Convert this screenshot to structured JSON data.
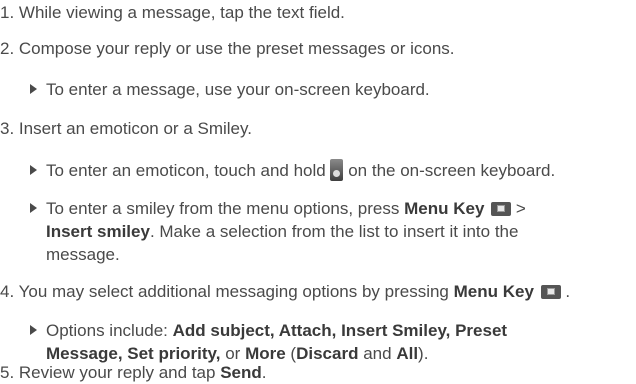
{
  "steps": {
    "s1": {
      "text": "1. While viewing a message, tap the text field."
    },
    "s2": {
      "text": "2. Compose your reply or use the preset messages or icons."
    },
    "s2_b1": {
      "text": "To enter a message, use your on-screen keyboard."
    },
    "s3": {
      "text": "3. Insert an emoticon or a Smiley."
    },
    "s3_b1": {
      "before": "To enter an emoticon, touch and hold",
      "after": "on the on-screen keyboard.",
      "icon": "emoticon-key-icon"
    },
    "s3_b2": {
      "before": "To enter a smiley from the menu options, press",
      "bold1": "Menu Key",
      "icon": "menu-key-icon",
      "gt": ">",
      "bold2": "Insert smiley",
      "after": ". Make a selection from the list to insert it into the",
      "line3": "message."
    },
    "s4": {
      "before": "4. You may select additional messaging options by pressing",
      "bold": "Menu Key",
      "icon": "menu-key-icon",
      "after": "."
    },
    "s4_b1": {
      "before": "Options include:",
      "bold1": "Add subject, Attach, Insert Smiley, Preset",
      "bold2": "Message, Set priority,",
      "mid": "or",
      "bold3": "More",
      "paren_open": "(",
      "bold4": "Discard",
      "and": "and",
      "bold5": "All",
      "paren_close": ")."
    },
    "s5": {
      "before": "5. Review your reply and tap",
      "bold": "Send",
      "after": "."
    }
  }
}
